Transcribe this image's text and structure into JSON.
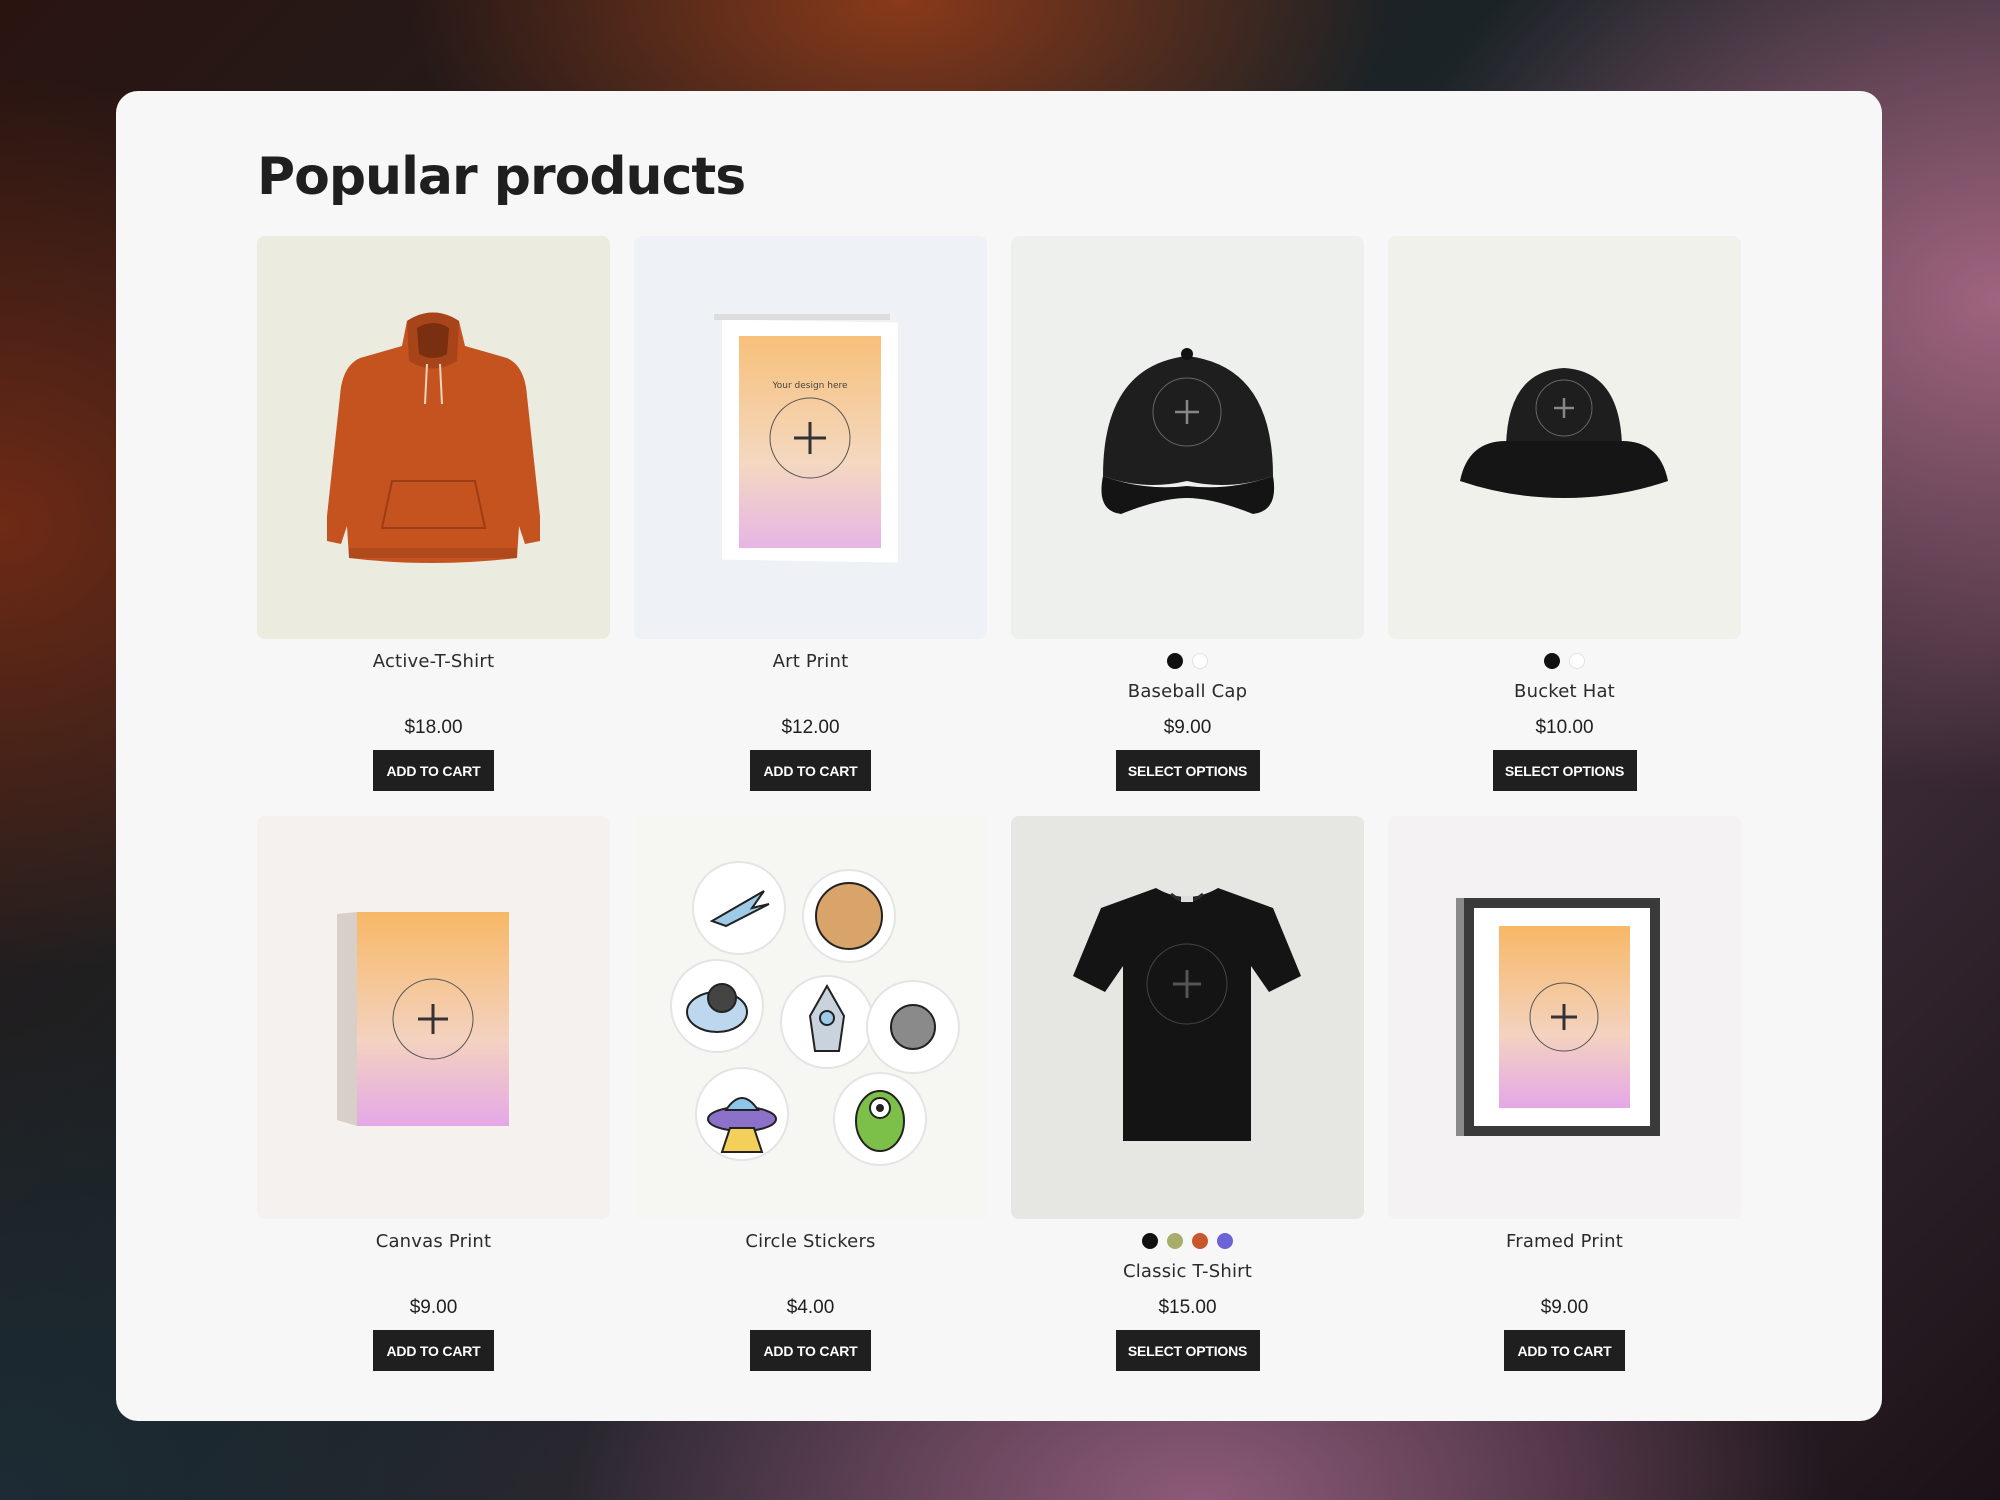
{
  "page": {
    "title": "Popular products"
  },
  "products": [
    {
      "name": "Active-T-Shirt",
      "price": "$18.00",
      "button": "ADD TO CART",
      "bg": "#ebebe0",
      "swatches": [],
      "icon": "hoodie-icon",
      "color": "#c4531f"
    },
    {
      "name": "Art Print",
      "price": "$12.00",
      "button": "ADD TO CART",
      "bg": "#eef1f5",
      "swatches": [],
      "icon": "art-print-icon"
    },
    {
      "name": "Baseball Cap",
      "price": "$9.00",
      "button": "SELECT OPTIONS",
      "bg": "#eef0ee",
      "swatches": [
        "#111111",
        "#ffffff"
      ],
      "icon": "baseball-cap-icon"
    },
    {
      "name": "Bucket Hat",
      "price": "$10.00",
      "button": "SELECT OPTIONS",
      "bg": "#f1f1ec",
      "swatches": [
        "#111111",
        "#ffffff"
      ],
      "icon": "bucket-hat-icon"
    },
    {
      "name": "Canvas Print",
      "price": "$9.00",
      "button": "ADD TO CART",
      "bg": "#f4f1ee",
      "swatches": [],
      "icon": "canvas-print-icon"
    },
    {
      "name": "Circle Stickers",
      "price": "$4.00",
      "button": "ADD TO CART",
      "bg": "#f6f6f2",
      "swatches": [],
      "icon": "circle-stickers-icon"
    },
    {
      "name": "Classic T-Shirt",
      "price": "$15.00",
      "button": "SELECT OPTIONS",
      "bg": "#e6e7e2",
      "swatches": [
        "#111111",
        "#a8ad6a",
        "#c9562d",
        "#6c63d6"
      ],
      "icon": "tshirt-icon"
    },
    {
      "name": "Framed Print",
      "price": "$9.00",
      "button": "ADD TO CART",
      "bg": "#f4f2f2",
      "swatches": [],
      "icon": "framed-print-icon"
    }
  ],
  "design_placeholder": "Your design here"
}
